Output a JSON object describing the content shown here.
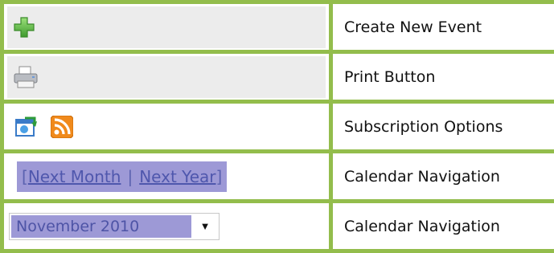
{
  "rows": [
    {
      "icon": "plus-icon",
      "description": "Create New Event"
    },
    {
      "icon": "printer-icon",
      "description": "Print Button"
    },
    {
      "icons": [
        "calendar-refresh-icon",
        "rss-icon"
      ],
      "description": "Subscription Options"
    },
    {
      "description": "Calendar Navigation"
    },
    {
      "description": "Calendar Navigation"
    }
  ],
  "navigation": {
    "open_bracket": "[",
    "next_month": "Next Month",
    "separator": "|",
    "next_year": "Next Year",
    "close_bracket": "]"
  },
  "month_select": {
    "value": "November 2010",
    "caret": "▼"
  },
  "colors": {
    "border": "#93bd4c",
    "nav_highlight": "#9d99d6",
    "link": "#4f57ad",
    "plus_green": "#5cb043",
    "rss_orange": "#f08a1c"
  }
}
